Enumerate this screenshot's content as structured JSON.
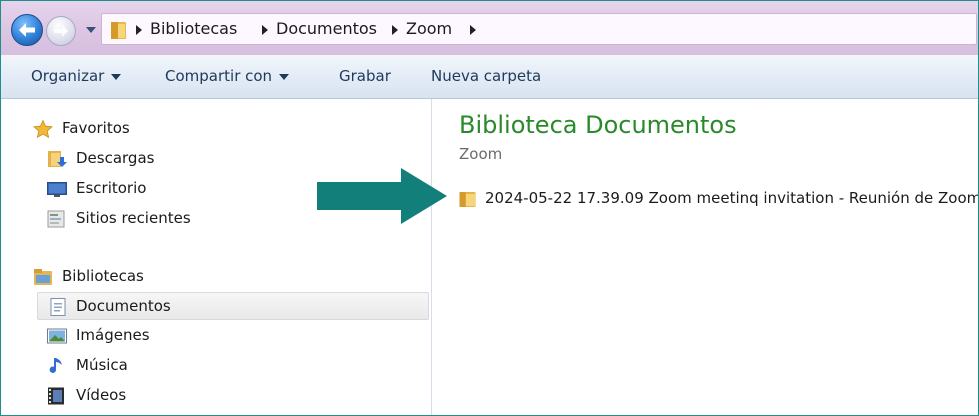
{
  "breadcrumb": {
    "items": [
      {
        "label": "Bibliotecas"
      },
      {
        "label": "Documentos"
      },
      {
        "label": "Zoom"
      }
    ]
  },
  "toolbar": {
    "organize_label": "Organizar",
    "share_label": "Compartir con",
    "burn_label": "Grabar",
    "new_folder_label": "Nueva carpeta"
  },
  "navpane": {
    "favorites": {
      "label": "Favoritos",
      "icon": "star-icon",
      "items": [
        {
          "label": "Descargas",
          "icon": "downloads-icon"
        },
        {
          "label": "Escritorio",
          "icon": "desktop-icon"
        },
        {
          "label": "Sitios recientes",
          "icon": "recent-places-icon"
        }
      ]
    },
    "libraries": {
      "label": "Bibliotecas",
      "icon": "libraries-icon",
      "items": [
        {
          "label": "Documentos",
          "icon": "documents-icon",
          "selected": true
        },
        {
          "label": "Imágenes",
          "icon": "pictures-icon"
        },
        {
          "label": "Música",
          "icon": "music-icon"
        },
        {
          "label": "Vídeos",
          "icon": "videos-icon"
        }
      ]
    }
  },
  "content": {
    "title": "Biblioteca Documentos",
    "subtitle": "Zoom",
    "files": [
      {
        "name": "2024-05-22 17.39.09 Zoom meetinq invitation - Reunión de Zoom",
        "icon": "folder-icon"
      }
    ]
  },
  "colors": {
    "title_green": "#2a8a2a",
    "arrow_teal": "#137f7a",
    "address_bar": "#dcc6e3",
    "toolbar": "#e4ecf6"
  }
}
